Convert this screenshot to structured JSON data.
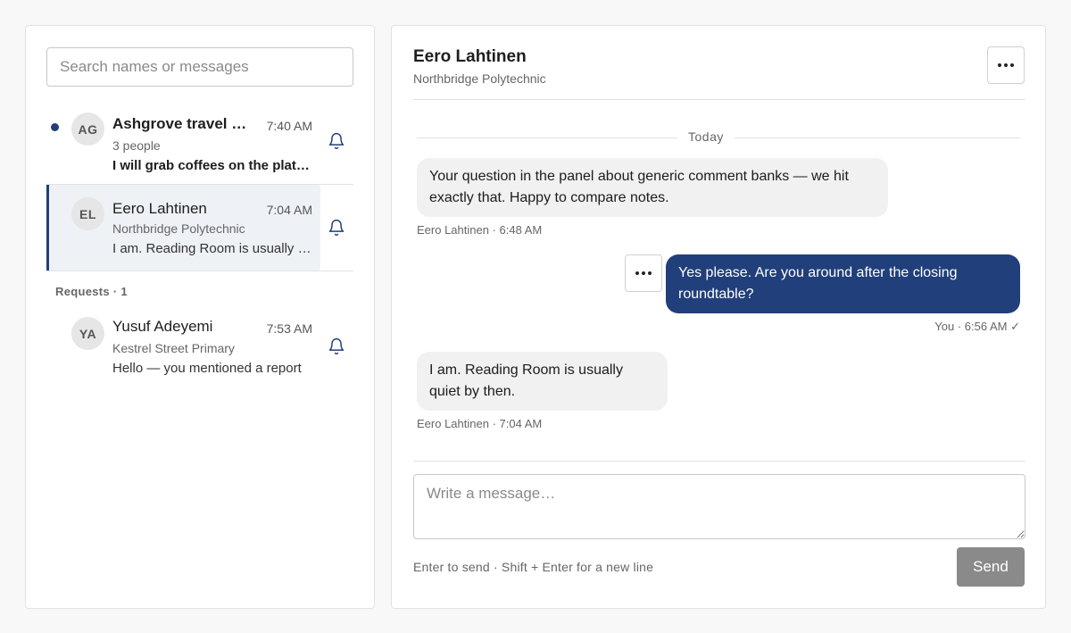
{
  "search": {
    "placeholder": "Search names or messages"
  },
  "conversations": [
    {
      "initials": "AG",
      "name": "Ashgrove travel group",
      "time": "7:40 AM",
      "subtitle": "3 people",
      "preview": "I will grab coffees on the platform",
      "unread": true
    },
    {
      "initials": "EL",
      "name": "Eero Lahtinen",
      "time": "7:04 AM",
      "subtitle": "Northbridge Polytechnic",
      "preview": "I am. Reading Room is usually quiet by then.",
      "selected": true
    }
  ],
  "requests": {
    "label": "Requests · 1",
    "items": [
      {
        "initials": "YA",
        "name": "Yusuf Adeyemi",
        "time": "7:53 AM",
        "subtitle": "Kestrel Street Primary",
        "preview": "Hello — you mentioned a report"
      }
    ]
  },
  "thread": {
    "name": "Eero Lahtinen",
    "subtitle": "Northbridge Polytechnic",
    "day_label": "Today",
    "messages": [
      {
        "direction": "in",
        "text": "Your question in the panel about generic comment banks — we hit exactly that. Happy to compare notes.",
        "meta": "Eero Lahtinen · 6:48 AM"
      },
      {
        "direction": "out",
        "text": "Yes please. Are you around after the closing roundtable?",
        "meta": "You · 6:56 AM ✓"
      },
      {
        "direction": "in",
        "text": "I am. Reading Room is usually quiet by then.",
        "meta": "Eero Lahtinen · 7:04 AM"
      }
    ]
  },
  "composer": {
    "placeholder": "Write a message…",
    "hint": "Enter to send · Shift + Enter for a new line",
    "send_label": "Send"
  },
  "colors": {
    "accent": "#213f7a",
    "send_disabled": "#8a8a8a",
    "incoming_bubble": "#f1f1f1"
  },
  "icons": {
    "more": "more-horizontal-icon",
    "notify": "bell-icon"
  }
}
